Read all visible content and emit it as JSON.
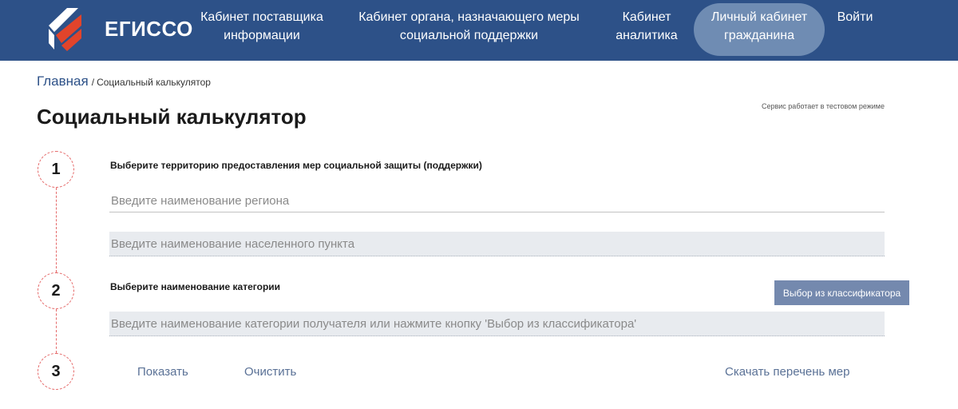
{
  "header": {
    "brand": "ЕГИССО",
    "nav": [
      {
        "line1": "Кабинет поставщика",
        "line2": "информации"
      },
      {
        "line1": "Кабинет органа, назначающего меры",
        "line2": "социальной поддержки"
      },
      {
        "line1": "Кабинет",
        "line2": "аналитика"
      },
      {
        "line1": "Личный кабинет",
        "line2": "гражданина",
        "active": true
      },
      {
        "line1": "Войти",
        "line2": ""
      }
    ],
    "colors": {
      "background": "#2d5188",
      "active_pill": "#6f8cb3"
    }
  },
  "breadcrumb": {
    "home": "Главная",
    "separator": "/",
    "current": "Социальный калькулятор"
  },
  "page": {
    "title": "Социальный калькулятор",
    "test_note": "Сервис работает в тестовом режиме"
  },
  "steps": [
    {
      "number": "1",
      "label": "Выберите территорию предоставления мер социальной защиты (поддержки)",
      "region_placeholder": "Введите наименование региона",
      "region_value": "",
      "locality_placeholder": "Введите наименование населенного пункта",
      "locality_value": ""
    },
    {
      "number": "2",
      "label": "Выберите наименование категории",
      "classifier_button": "Выбор из классификатора",
      "category_placeholder": "Введите наименование категории получателя или нажмите кнопку 'Выбор из классификатора'",
      "category_value": ""
    },
    {
      "number": "3",
      "show": "Показать",
      "clear": "Очистить",
      "download": "Скачать перечень мер"
    }
  ]
}
